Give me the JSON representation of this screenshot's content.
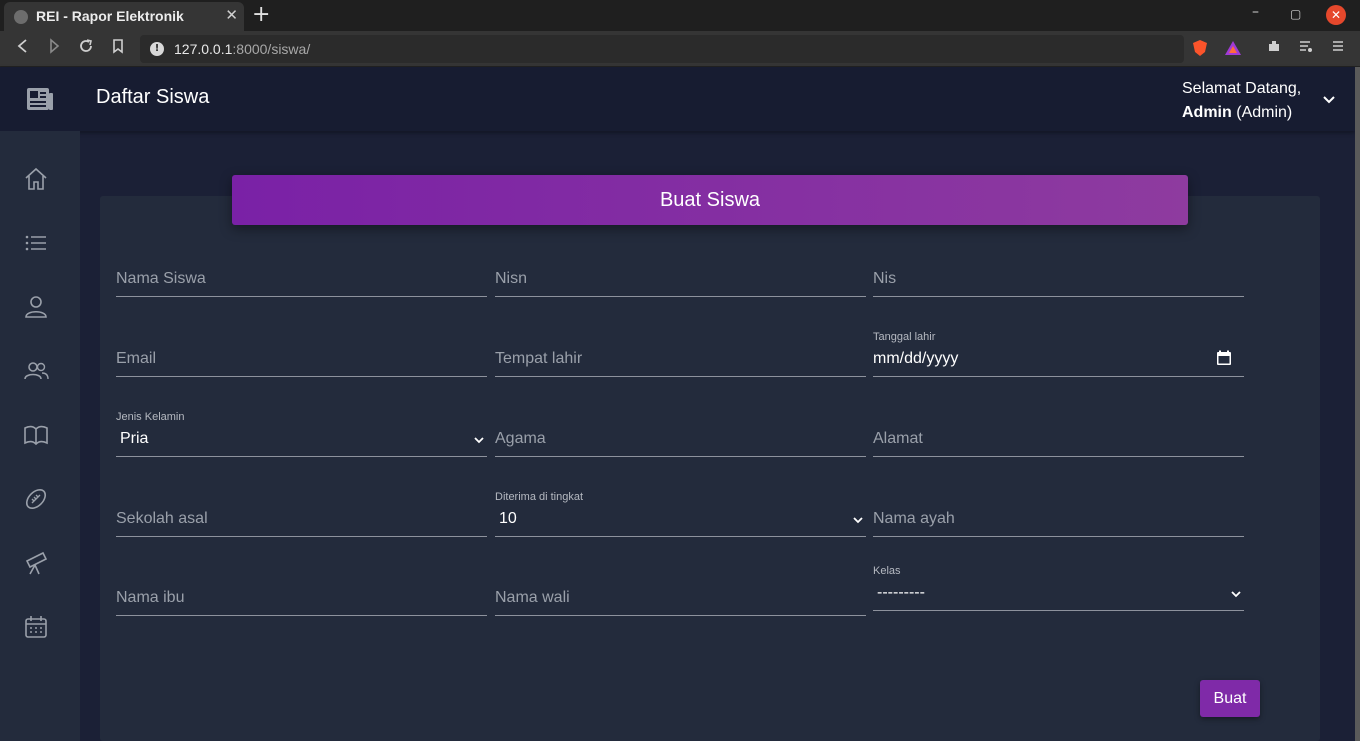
{
  "browser": {
    "tab_title": "REI - Rapor Elektronik",
    "url_host": "127.0.0.1",
    "url_rest": ":8000/siswa/"
  },
  "header": {
    "page_title": "Daftar Siswa",
    "welcome_line": "Selamat Datang,",
    "user_name": "Admin",
    "user_role": "(Admin)"
  },
  "sidebar": {
    "items": [
      "home-icon",
      "list-icon",
      "user-icon",
      "users-icon",
      "book-icon",
      "football-icon",
      "telescope-icon",
      "calendar-icon"
    ]
  },
  "form": {
    "title": "Buat Siswa",
    "nama_siswa": {
      "placeholder": "Nama Siswa"
    },
    "nisn": {
      "placeholder": "Nisn"
    },
    "nis": {
      "placeholder": "Nis"
    },
    "email": {
      "placeholder": "Email"
    },
    "tempat_lahir": {
      "placeholder": "Tempat lahir"
    },
    "tanggal_lahir": {
      "label": "Tanggal lahir",
      "value": "mm/dd/yyyy"
    },
    "jenis_kelamin": {
      "label": "Jenis Kelamin",
      "value": "Pria"
    },
    "agama": {
      "placeholder": "Agama"
    },
    "alamat": {
      "placeholder": "Alamat"
    },
    "sekolah_asal": {
      "placeholder": "Sekolah asal"
    },
    "diterima_di_tingkat": {
      "label": "Diterima di tingkat",
      "value": "10"
    },
    "nama_ayah": {
      "placeholder": "Nama ayah"
    },
    "nama_ibu": {
      "placeholder": "Nama ibu"
    },
    "nama_wali": {
      "placeholder": "Nama wali"
    },
    "kelas": {
      "label": "Kelas",
      "value": "---------"
    },
    "submit_label": "Buat"
  },
  "colors": {
    "accent": "#7f2aa8",
    "background": "#1b2036",
    "card": "#232b3c"
  }
}
